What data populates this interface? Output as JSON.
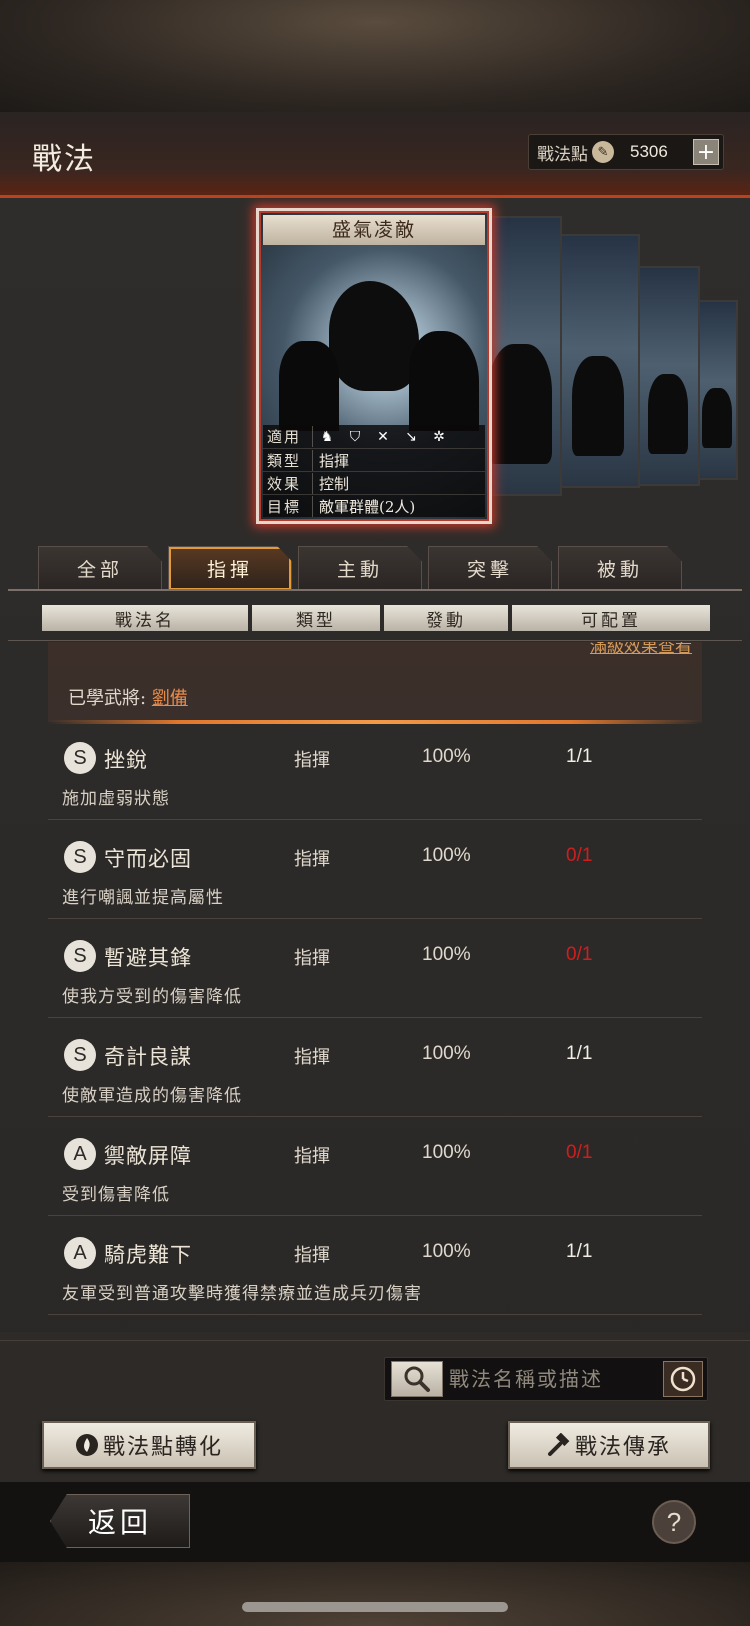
{
  "header": {
    "title": "戰法",
    "points_label": "戰法點",
    "points_value": "5306",
    "plus_label": "+"
  },
  "featured_card": {
    "name": "盛氣凌敵",
    "applicable_label": "適用",
    "type_label": "類型",
    "type_value": "指揮",
    "effect_label": "效果",
    "effect_value": "控制",
    "target_label": "目標",
    "target_value": "敵軍群體(2人)",
    "troop_icons": [
      "cavalry-icon",
      "shield-icon",
      "bow-icon",
      "spear-icon",
      "siege-icon"
    ]
  },
  "tabs": [
    {
      "label": "全部",
      "active": false
    },
    {
      "label": "指揮",
      "active": true
    },
    {
      "label": "主動",
      "active": false
    },
    {
      "label": "突擊",
      "active": false
    },
    {
      "label": "被動",
      "active": false
    }
  ],
  "columns": [
    "戰法名",
    "類型",
    "發動",
    "可配置"
  ],
  "expanded": {
    "link_text": "滿級效果查看",
    "learned_label": "已學武將:",
    "learned_name": "劉備"
  },
  "tactics": [
    {
      "grade": "S",
      "name": "挫銳",
      "type": "指揮",
      "rate": "100%",
      "slots": "1/1",
      "available": true,
      "desc": "施加虛弱狀態"
    },
    {
      "grade": "S",
      "name": "守而必固",
      "type": "指揮",
      "rate": "100%",
      "slots": "0/1",
      "available": false,
      "desc": "進行嘲諷並提高屬性"
    },
    {
      "grade": "S",
      "name": "暫避其鋒",
      "type": "指揮",
      "rate": "100%",
      "slots": "0/1",
      "available": false,
      "desc": "使我方受到的傷害降低"
    },
    {
      "grade": "S",
      "name": "奇計良謀",
      "type": "指揮",
      "rate": "100%",
      "slots": "1/1",
      "available": true,
      "desc": "使敵軍造成的傷害降低"
    },
    {
      "grade": "A",
      "name": "禦敵屏障",
      "type": "指揮",
      "rate": "100%",
      "slots": "0/1",
      "available": false,
      "desc": "受到傷害降低"
    },
    {
      "grade": "A",
      "name": "騎虎難下",
      "type": "指揮",
      "rate": "100%",
      "slots": "1/1",
      "available": true,
      "desc": "友軍受到普通攻擊時獲得禁療並造成兵刃傷害"
    }
  ],
  "search": {
    "placeholder": "戰法名稱或描述"
  },
  "buttons": {
    "convert": "戰法點轉化",
    "inherit": "戰法傳承",
    "back": "返回",
    "help": "?"
  },
  "colors": {
    "accent_orange": "#e39a3a",
    "unavailable_red": "#d01e1e",
    "available_white": "#f2eee6"
  }
}
